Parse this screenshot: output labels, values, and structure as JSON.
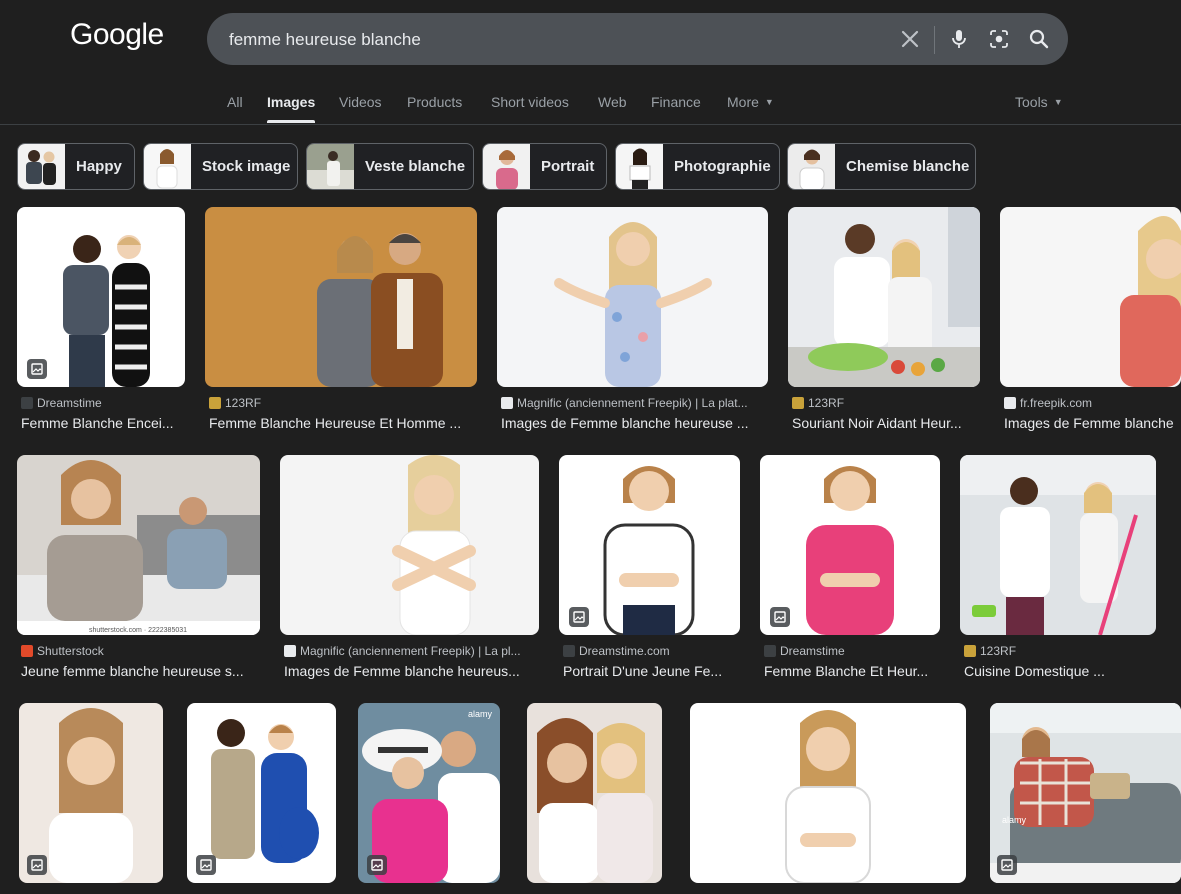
{
  "logo": "Google",
  "search": {
    "query": "femme heureuse blanche"
  },
  "tabs": [
    {
      "label": "All"
    },
    {
      "label": "Images"
    },
    {
      "label": "Videos"
    },
    {
      "label": "Products"
    },
    {
      "label": "Short videos"
    },
    {
      "label": "Web"
    },
    {
      "label": "Finance"
    },
    {
      "label": "More"
    }
  ],
  "tools_label": "Tools",
  "chips": [
    {
      "label": "Happy"
    },
    {
      "label": "Stock image"
    },
    {
      "label": "Veste blanche"
    },
    {
      "label": "Portrait"
    },
    {
      "label": "Photographie"
    },
    {
      "label": "Chemise blanche"
    }
  ],
  "results": [
    {
      "source": "Dreamstime",
      "title": "Femme Blanche Encei...",
      "icon": "dreamstime-icon"
    },
    {
      "source": "123RF",
      "title": "Femme Blanche Heureuse Et Homme ...",
      "icon": "123rf-icon"
    },
    {
      "source": "Magnific (anciennement Freepik) | La plat...",
      "title": "Images de Femme blanche heureuse ...",
      "icon": "magnific-icon"
    },
    {
      "source": "123RF",
      "title": "Souriant Noir Aidant Heur...",
      "icon": "123rf-icon"
    },
    {
      "source": "fr.freepik.com",
      "title": "Images de Femme blanche",
      "icon": "magnific-icon"
    },
    {
      "source": "Shutterstock",
      "title": "Jeune femme blanche heureuse s...",
      "icon": "shutterstock-icon"
    },
    {
      "source": "Magnific (anciennement Freepik) | La pl...",
      "title": "Images de Femme blanche heureus...",
      "icon": "magnific-icon"
    },
    {
      "source": "Dreamstime.com",
      "title": "Portrait D'une Jeune Fe...",
      "icon": "dreamstime-icon"
    },
    {
      "source": "Dreamstime",
      "title": "Femme Blanche Et Heur...",
      "icon": "dreamstime-icon"
    },
    {
      "source": "123RF",
      "title": "Cuisine Domestique ...",
      "icon": "123rf-icon"
    }
  ],
  "image_labels": {
    "shutterstock_caption": "shutterstock.com · 2222385031",
    "alamy": "alamy"
  },
  "colors": {
    "background": "#1f1f1f",
    "searchbar": "#4d5156",
    "text_primary": "#e8eaed",
    "text_secondary": "#9aa0a6"
  }
}
